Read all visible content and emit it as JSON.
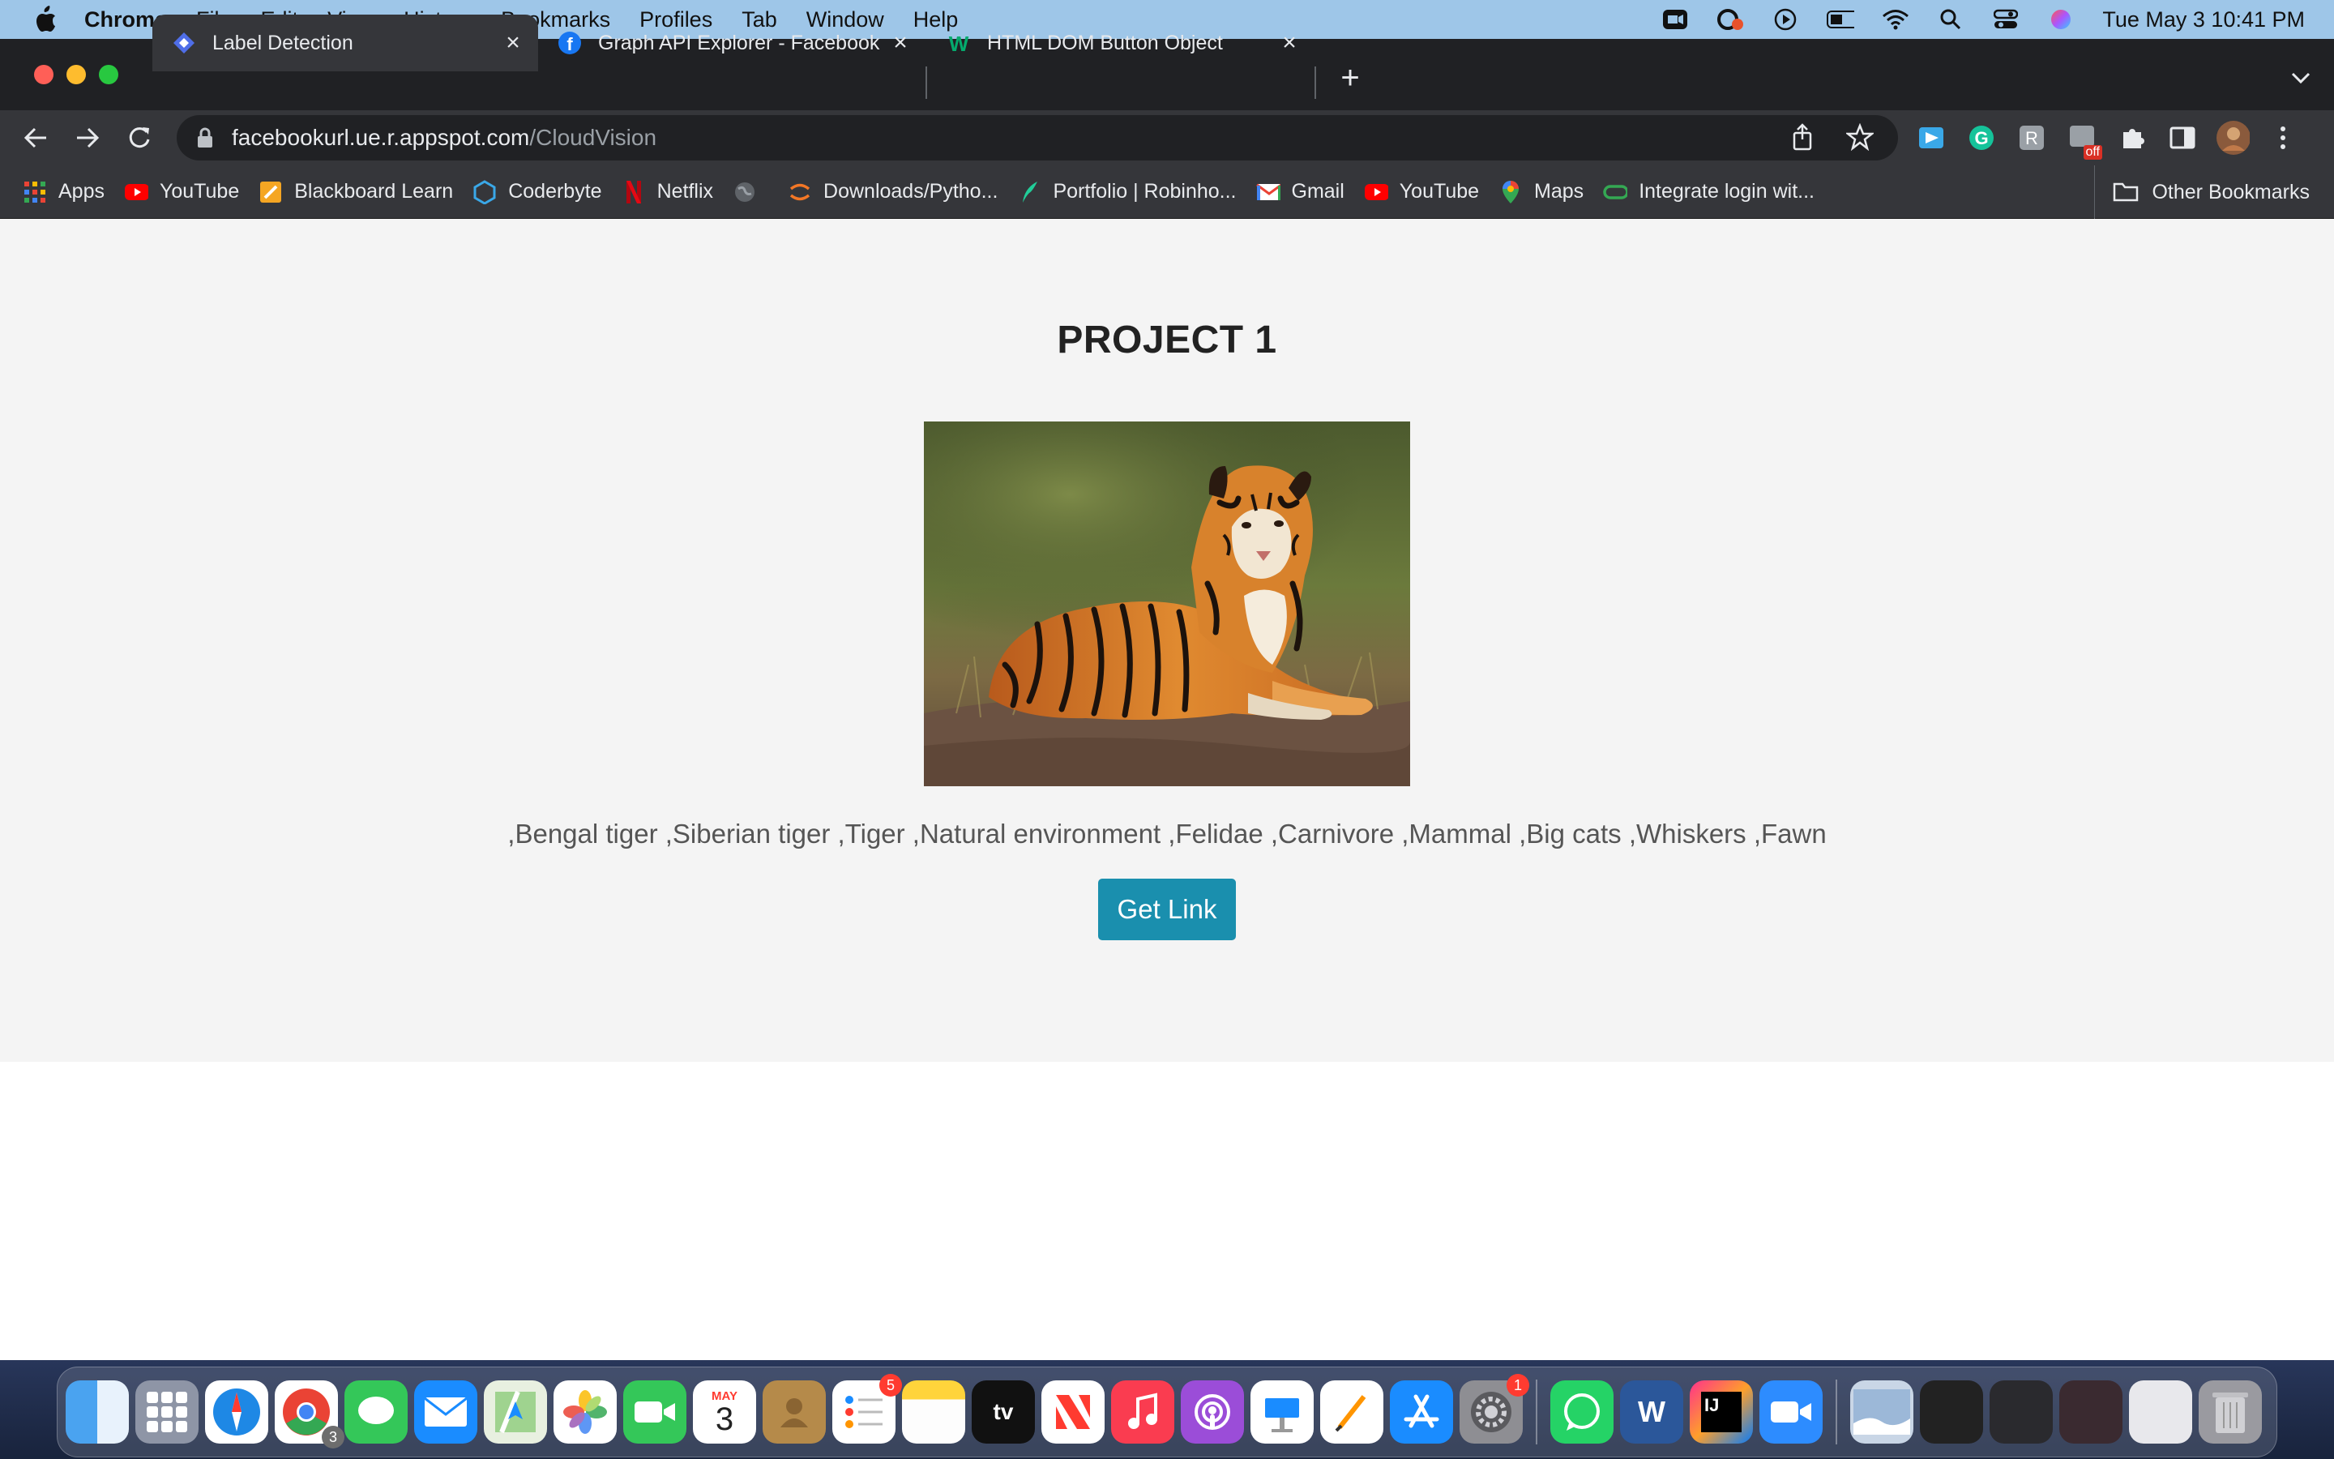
{
  "menubar": {
    "app_name": "Chrome",
    "menus": [
      "File",
      "Edit",
      "View",
      "History",
      "Bookmarks",
      "Profiles",
      "Tab",
      "Window",
      "Help"
    ],
    "datetime": "Tue May 3  10:41 PM"
  },
  "tabs": [
    {
      "title": "Label Detection",
      "favicon": "cloud-vision-icon",
      "active": true
    },
    {
      "title": "Graph API Explorer - Facebook",
      "favicon": "facebook-icon",
      "active": false
    },
    {
      "title": "HTML DOM Button Object",
      "favicon": "w3schools-icon",
      "active": false
    }
  ],
  "address_bar": {
    "host": "facebookurl.ue.r.appspot.com",
    "path": "/CloudVision"
  },
  "bookmarks": [
    {
      "label": "Apps",
      "icon": "apps-grid-icon"
    },
    {
      "label": "YouTube",
      "icon": "youtube-icon"
    },
    {
      "label": "Blackboard Learn",
      "icon": "blackboard-icon"
    },
    {
      "label": "Coderbyte",
      "icon": "coderbyte-icon"
    },
    {
      "label": "Netflix",
      "icon": "netflix-icon"
    },
    {
      "label": "",
      "icon": "globe-icon"
    },
    {
      "label": "Downloads/Pytho...",
      "icon": "jupyter-icon"
    },
    {
      "label": "Portfolio | Robinho...",
      "icon": "robinhood-icon"
    },
    {
      "label": "Gmail",
      "icon": "gmail-icon"
    },
    {
      "label": "YouTube",
      "icon": "youtube-icon"
    },
    {
      "label": "Maps",
      "icon": "maps-icon"
    },
    {
      "label": "Integrate login wit...",
      "icon": "link-icon"
    }
  ],
  "other_bookmarks": "Other Bookmarks",
  "page": {
    "heading": "PROJECT 1",
    "labels_text": ",Bengal tiger ,Siberian tiger ,Tiger ,Natural environment ,Felidae ,Carnivore ,Mammal ,Big cats ,Whiskers ,Fawn",
    "button_label": "Get Link"
  },
  "extension_badge": "off",
  "dock": {
    "calendar_month": "MAY",
    "calendar_day": "3",
    "badges": {
      "chrome": "3",
      "reminders": "5",
      "settings": "1"
    }
  }
}
